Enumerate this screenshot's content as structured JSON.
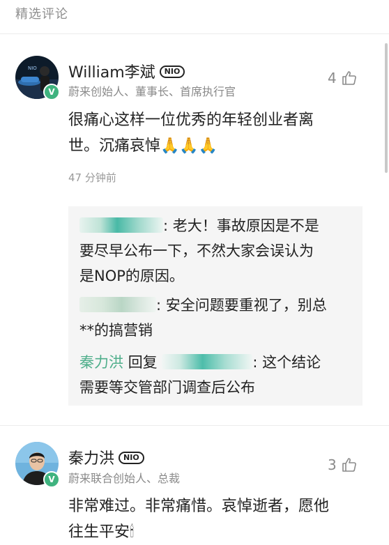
{
  "section": {
    "title": "精选评论"
  },
  "comments": [
    {
      "name": "William李斌",
      "badge": "NIO",
      "role": "蔚来创始人、董事长、首席执行官",
      "likes": "4",
      "text_line1": "很痛心这样一位优秀的年轻创业者离",
      "text_line2": "世。沉痛哀悼🙏🙏🙏",
      "time": "47 分钟前",
      "avatar_icon": "avatar-photo-william",
      "verified_icon": "verified-v-icon",
      "replies": [
        {
          "author": "",
          "line1": ": 老大！事故原因是不是",
          "line2": "要尽早公布一下，不然大家会误认为",
          "line3": "是NOP的原因。"
        },
        {
          "author": "",
          "line1": ": 安全问题要重视了，别总",
          "line2": "**的搞营销"
        },
        {
          "author": "秦力洪",
          "reply_word": "回复",
          "line1": ": 这个结论",
          "line2": "需要等交管部门调查后公布"
        }
      ]
    },
    {
      "name": "秦力洪",
      "badge": "NIO",
      "role": "蔚来联合创始人、总裁",
      "likes": "3",
      "text_line1": "非常难过。非常痛惜。哀悼逝者，愿他",
      "text_line2": "往生平安🕯",
      "avatar_icon": "avatar-photo-qin",
      "verified_icon": "verified-v-icon"
    }
  ],
  "icons": {
    "like": "thumbs-up-icon"
  },
  "colors": {
    "name_highlight": "#4fae8b",
    "verified": "#3fb37f",
    "reply_bg": "#f5f5f5"
  }
}
